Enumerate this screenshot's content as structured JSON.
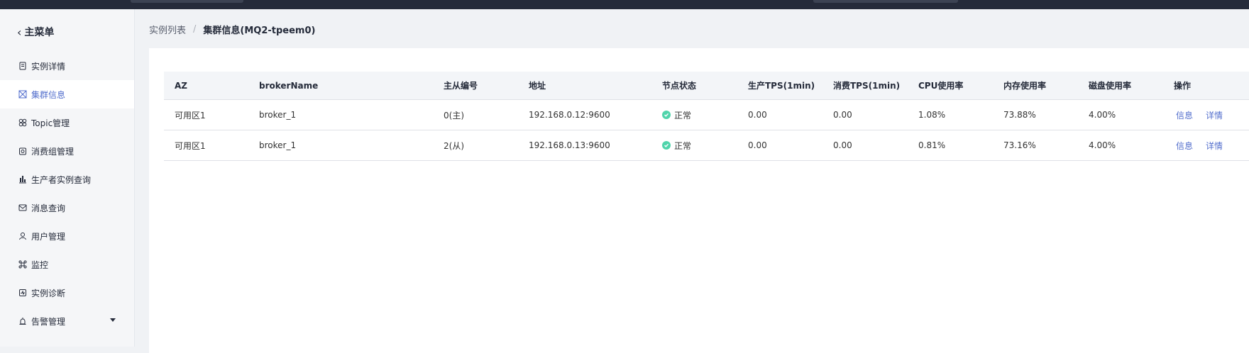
{
  "topbar": {
    "logo_text": ""
  },
  "sidebar": {
    "back_label": "主菜单",
    "items": [
      {
        "label": "实例详情",
        "icon": "document-icon",
        "active": false
      },
      {
        "label": "集群信息",
        "icon": "cluster-icon",
        "active": true
      },
      {
        "label": "Topic管理",
        "icon": "grid-icon",
        "active": false
      },
      {
        "label": "消费组管理",
        "icon": "group-icon",
        "active": false
      },
      {
        "label": "生产者实例查询",
        "icon": "bar-chart-icon",
        "active": false
      },
      {
        "label": "消息查询",
        "icon": "message-icon",
        "active": false
      },
      {
        "label": "用户管理",
        "icon": "user-icon",
        "active": false
      },
      {
        "label": "监控",
        "icon": "monitor-icon",
        "active": false
      },
      {
        "label": "实例诊断",
        "icon": "diagnose-icon",
        "active": false
      },
      {
        "label": "告警管理",
        "icon": "alarm-icon",
        "active": false,
        "expandable": true
      }
    ]
  },
  "breadcrumb": {
    "parent": "实例列表",
    "separator": "/",
    "current": "集群信息(MQ2-tpeem0)"
  },
  "table": {
    "columns": [
      "AZ",
      "brokerName",
      "主从编号",
      "地址",
      "节点状态",
      "生产TPS(1min)",
      "消费TPS(1min)",
      "CPU使用率",
      "内存使用率",
      "磁盘使用率",
      "操作"
    ],
    "rows": [
      {
        "az": "可用区1",
        "broker": "broker_1",
        "role": "0(主)",
        "address": "192.168.0.12:9600",
        "status": "正常",
        "produce_tps": "0.00",
        "consume_tps": "0.00",
        "cpu": "1.08%",
        "mem": "73.88%",
        "disk": "4.00%",
        "op1": "信息",
        "op2": "详情"
      },
      {
        "az": "可用区1",
        "broker": "broker_1",
        "role": "2(从)",
        "address": "192.168.0.13:9600",
        "status": "正常",
        "produce_tps": "0.00",
        "consume_tps": "0.00",
        "cpu": "0.81%",
        "mem": "73.16%",
        "disk": "4.00%",
        "op1": "信息",
        "op2": "详情"
      }
    ]
  },
  "colors": {
    "accent": "#526ecc",
    "status_ok": "#50d4ab",
    "topbar": "#252b3a"
  }
}
